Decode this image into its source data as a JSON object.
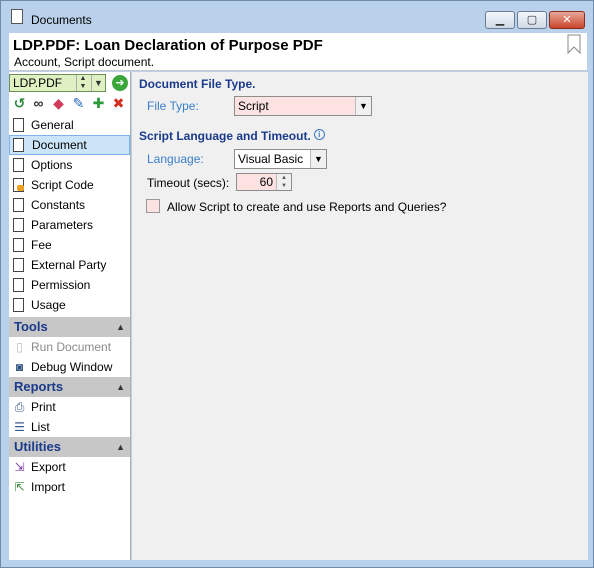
{
  "window": {
    "title": "Documents"
  },
  "header": {
    "title": "LDP.PDF: Loan Declaration of Purpose PDF",
    "subtitle": "Account, Script document."
  },
  "record_selector": {
    "value": "LDP.PDF"
  },
  "toolbar": {
    "icons": [
      "history-icon",
      "binoculars-icon",
      "eraser-icon",
      "pencil-icon",
      "plus-icon",
      "delete-icon"
    ]
  },
  "nav": {
    "items": [
      {
        "label": "General",
        "icon": "page-icon"
      },
      {
        "label": "Document",
        "icon": "page-icon",
        "selected": true
      },
      {
        "label": "Options",
        "icon": "page-icon"
      },
      {
        "label": "Script Code",
        "icon": "script-icon"
      },
      {
        "label": "Constants",
        "icon": "page-icon"
      },
      {
        "label": "Parameters",
        "icon": "page-icon"
      },
      {
        "label": "Fee",
        "icon": "page-icon"
      },
      {
        "label": "External Party",
        "icon": "page-icon"
      },
      {
        "label": "Permission",
        "icon": "page-icon"
      },
      {
        "label": "Usage",
        "icon": "page-icon"
      }
    ]
  },
  "sections": {
    "tools": {
      "title": "Tools",
      "items": [
        {
          "label": "Run Document",
          "disabled": true
        },
        {
          "label": "Debug Window"
        }
      ]
    },
    "reports": {
      "title": "Reports",
      "items": [
        {
          "label": "Print"
        },
        {
          "label": "List"
        }
      ]
    },
    "utilities": {
      "title": "Utilities",
      "items": [
        {
          "label": "Export"
        },
        {
          "label": "Import"
        }
      ]
    }
  },
  "document_file_type": {
    "group_title": "Document File Type.",
    "file_type_label": "File Type:",
    "file_type_value": "Script"
  },
  "script_language": {
    "group_title": "Script Language and Timeout.",
    "language_label": "Language:",
    "language_value": "Visual Basic",
    "timeout_label": "Timeout (secs):",
    "timeout_value": "60",
    "allow_reports_label": "Allow Script to create and use Reports and Queries?",
    "allow_reports_checked": false
  },
  "colors": {
    "frame": "#b9d1ea",
    "section_header": "#c7c7c7",
    "section_title": "#1a3a8a",
    "selected_row": "#cce4f7",
    "required_field": "#fde2e2",
    "record_combo": "#dff1c3",
    "field_label_blue": "#3a7dc8"
  }
}
